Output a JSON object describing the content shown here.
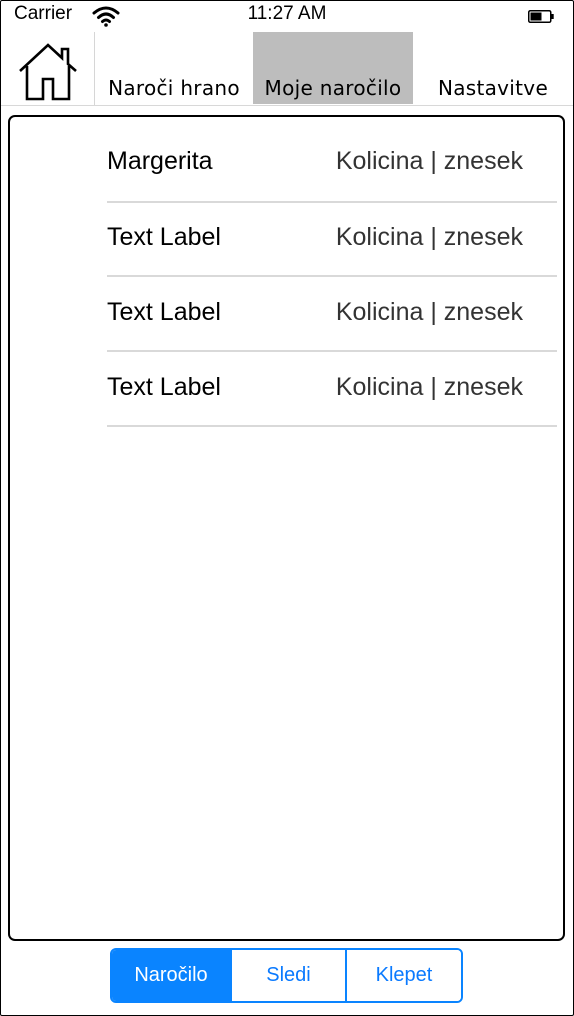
{
  "status_bar": {
    "carrier": "Carrier",
    "time": "11:27 AM",
    "icons": [
      "wifi-icon",
      "battery-icon"
    ]
  },
  "nav": {
    "home_icon": "home-icon",
    "tabs": [
      {
        "label": "Naroči hrano",
        "selected": false
      },
      {
        "label": "Moje naročilo",
        "selected": true
      },
      {
        "label": "Nastavitve",
        "selected": false
      }
    ],
    "selected_tab_color": "#bdbdbd"
  },
  "order_table": {
    "rows": [
      {
        "name": "Margerita",
        "detail": "Kolicina | znesek"
      },
      {
        "name": "Text Label",
        "detail": "Kolicina | znesek"
      },
      {
        "name": "Text Label",
        "detail": "Kolicina | znesek"
      },
      {
        "name": "Text Label",
        "detail": "Kolicina | znesek"
      }
    ]
  },
  "segmented_control": {
    "segments": [
      {
        "label": "Naročilo",
        "selected": true
      },
      {
        "label": "Sledi",
        "selected": false
      },
      {
        "label": "Klepet",
        "selected": false
      }
    ],
    "accent_color": "#0a84ff"
  }
}
